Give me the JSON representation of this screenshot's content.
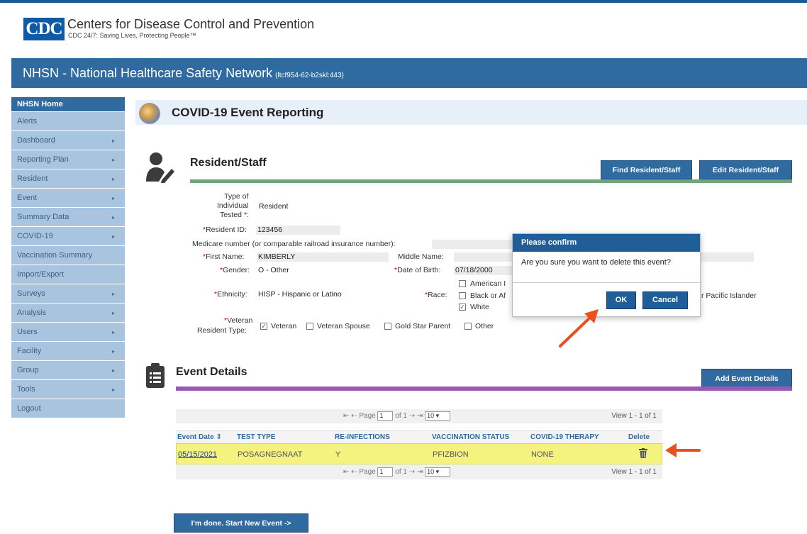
{
  "header": {
    "logo_text": "CDC",
    "org_name": "Centers for Disease Control and Prevention",
    "tagline": "CDC 24/7: Saving Lives, Protecting People™"
  },
  "banner": {
    "title": "NHSN - National Healthcare Safety Network",
    "server": "(ltcf954-62-b2skl:443)"
  },
  "sidebar": {
    "items": [
      {
        "label": "NHSN Home",
        "has_submenu": false
      },
      {
        "label": "Alerts",
        "has_submenu": false
      },
      {
        "label": "Dashboard",
        "has_submenu": true
      },
      {
        "label": "Reporting Plan",
        "has_submenu": true
      },
      {
        "label": "Resident",
        "has_submenu": true
      },
      {
        "label": "Event",
        "has_submenu": true
      },
      {
        "label": "Summary Data",
        "has_submenu": true
      },
      {
        "label": "COVID-19",
        "has_submenu": true
      },
      {
        "label": "Vaccination Summary",
        "has_submenu": false
      },
      {
        "label": "Import/Export",
        "has_submenu": false
      },
      {
        "label": "Surveys",
        "has_submenu": true
      },
      {
        "label": "Analysis",
        "has_submenu": true
      },
      {
        "label": "Users",
        "has_submenu": true
      },
      {
        "label": "Facility",
        "has_submenu": true
      },
      {
        "label": "Group",
        "has_submenu": true
      },
      {
        "label": "Tools",
        "has_submenu": true
      },
      {
        "label": "Logout",
        "has_submenu": false
      }
    ],
    "arrow": "▸"
  },
  "page": {
    "title": "COVID-19 Event Reporting"
  },
  "resident": {
    "section_title": "Resident/Staff",
    "find_button": "Find Resident/Staff",
    "edit_button": "Edit Resident/Staff",
    "type_label_1": "Type of",
    "type_label_2": "Individual",
    "type_label_3": "Tested",
    "type_value": "Resident",
    "required_mark": "*",
    "resident_id_label": "Resident ID:",
    "resident_id_value": "123456",
    "medicare_label": "Medicare number (or comparable railroad insurance number):",
    "first_name_label": "First Name:",
    "first_name_value": "KIMBERLY",
    "middle_name_label": "Middle Name:",
    "gender_label": "Gender:",
    "gender_value": "O - Other",
    "dob_label": "Date of Birth:",
    "dob_value": "07/18/2000",
    "ethnicity_label": "Ethnicity:",
    "ethnicity_value": "HISP - Hispanic or Latino",
    "race_label": "Race:",
    "race_option_1": "American I",
    "race_option_2": "Black or Af",
    "race_option_3": "White",
    "race_option_partial": "r Pacific Islander",
    "veteran_label_1": "Veteran",
    "veteran_label_2": "Resident Type:",
    "veteran_options": [
      {
        "label": "Veteran",
        "checked": true
      },
      {
        "label": "Veteran Spouse",
        "checked": false
      },
      {
        "label": "Gold Star Parent",
        "checked": false
      },
      {
        "label": "Other",
        "checked": false
      }
    ]
  },
  "events": {
    "section_title": "Event Details",
    "add_button": "Add Event Details",
    "pager": {
      "first": "⇤",
      "prev": "⇠",
      "page_label": "Page",
      "page_value": "1",
      "of_label": "of 1",
      "next": "⇢",
      "last": "⇥",
      "per_page": "10",
      "view_text": "View 1 - 1 of 1"
    },
    "columns": [
      "Event Date",
      "TEST TYPE",
      "RE-INFECTIONS",
      "VACCINATION STATUS",
      "COVID-19 THERAPY",
      "Delete"
    ],
    "sort_icon": "⇕",
    "rows": [
      {
        "event_date": "05/15/2021",
        "test_type": "POSAGNEGNAAT",
        "reinfections": "Y",
        "vaccination_status": "PFIZBION",
        "therapy": "NONE"
      }
    ]
  },
  "footer": {
    "done_button": "I'm done.  Start New Event ->"
  },
  "dialog": {
    "title": "Please confirm",
    "message": "Are you sure you want to delete this event?",
    "ok": "OK",
    "cancel": "Cancel"
  },
  "colors": {
    "brand_blue": "#2f6aa0",
    "sidebar_bg": "#a9c4de",
    "green_rule": "#6fa779",
    "purple_rule": "#9b59b6",
    "highlight_row": "#f4f37f",
    "arrow": "#e8501e"
  }
}
